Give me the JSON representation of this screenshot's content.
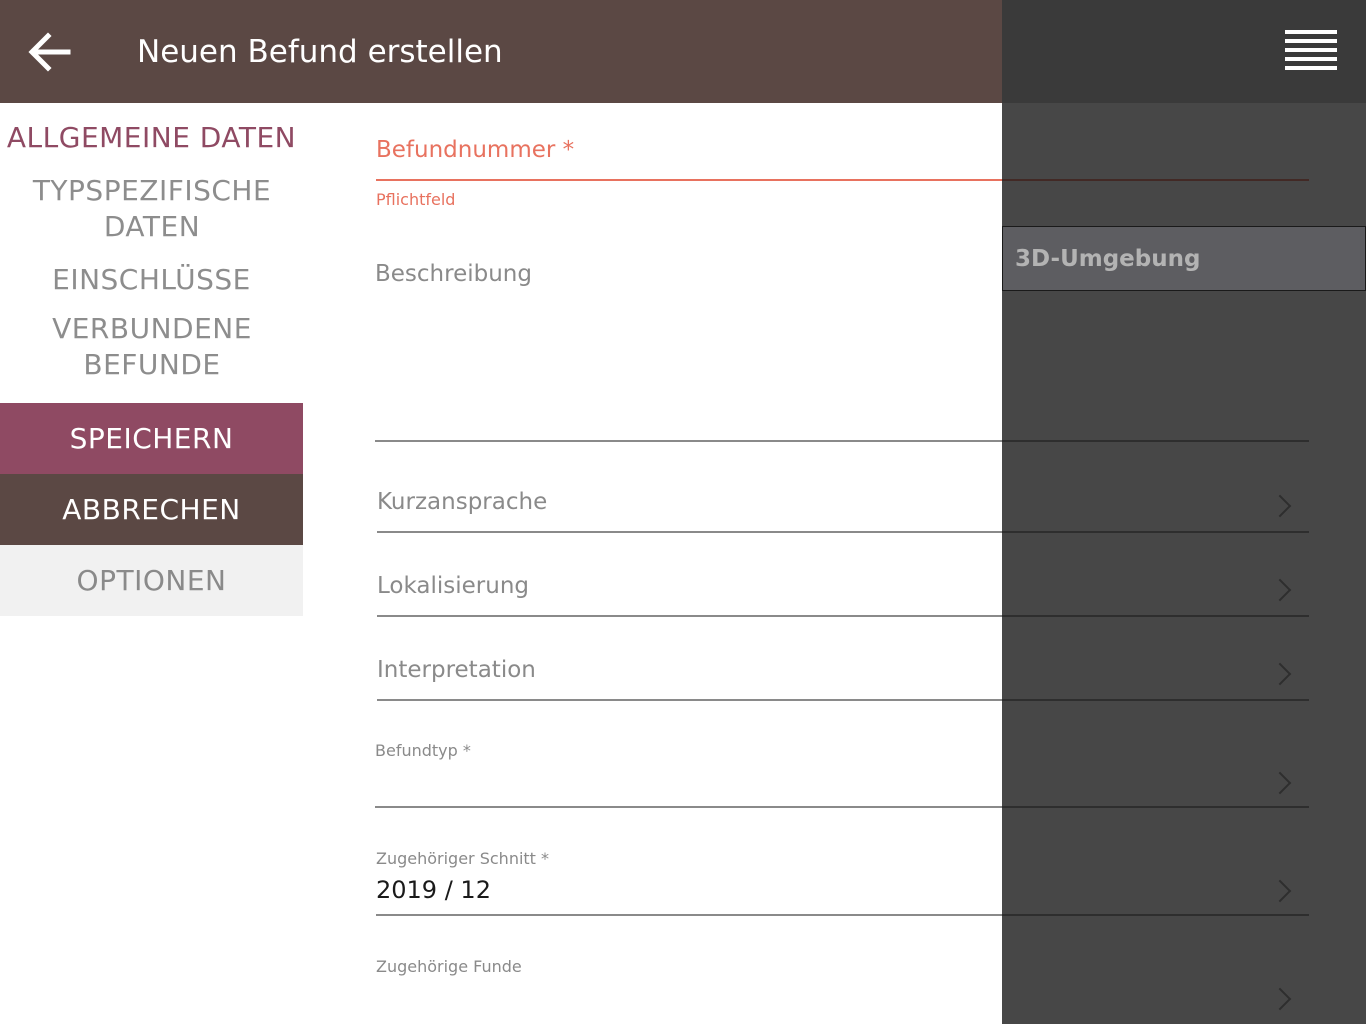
{
  "header": {
    "title": "Neuen Befund erstellen",
    "back_icon": "arrow-left-icon",
    "menu_icon": "hamburger-menu-icon"
  },
  "sidenav": {
    "items": [
      {
        "label": "ALLGEMEINE DATEN",
        "active": true
      },
      {
        "label": "TYPSPEZIFISCHE DATEN",
        "active": false
      },
      {
        "label": "EINSCHLÜSSE",
        "active": false
      },
      {
        "label": "VERBUNDENE BEFUNDE",
        "active": false
      }
    ],
    "save_label": "SPEICHERN",
    "cancel_label": "ABBRECHEN",
    "options_label": "OPTIONEN"
  },
  "form": {
    "befundnummer": {
      "label": "Befundnummer *",
      "value": "",
      "error": "Pflichtfeld"
    },
    "beschreibung": {
      "label": "Beschreibung",
      "value": ""
    },
    "kurzansprache": {
      "label": "Kurzansprache",
      "value": ""
    },
    "lokalisierung": {
      "label": "Lokalisierung",
      "value": ""
    },
    "interpretation": {
      "label": "Interpretation",
      "value": ""
    },
    "befundtyp": {
      "label": "Befundtyp *",
      "value": ""
    },
    "schnitt": {
      "label": "Zugehöriger Schnitt *",
      "value": "2019 / 12"
    },
    "funde": {
      "label": "Zugehörige Funde",
      "value": ""
    }
  },
  "drawer": {
    "items": [
      {
        "label": "3D-Umgebung"
      }
    ]
  },
  "colors": {
    "header_bg": "#5b4844",
    "accent": "#8f4a63",
    "error": "#e8725f",
    "overlay": "#3a3a3a"
  }
}
